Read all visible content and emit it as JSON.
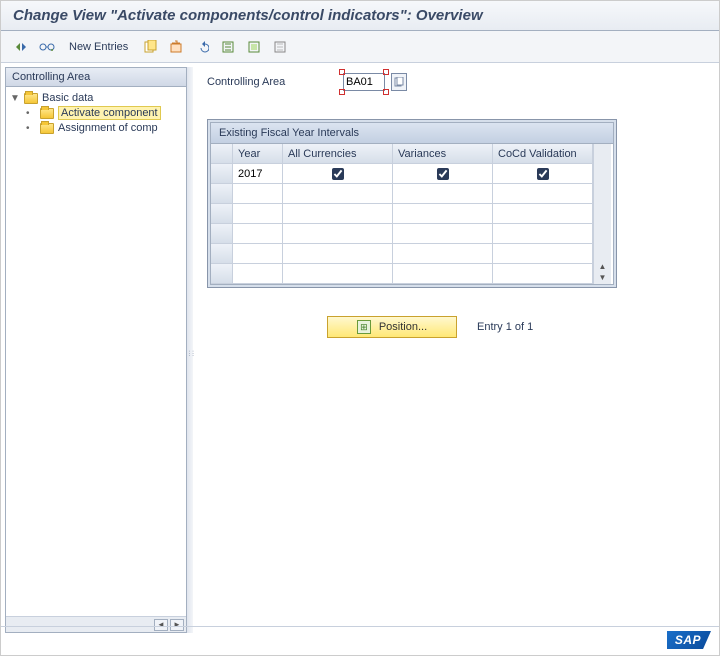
{
  "title": "Change View \"Activate components/control indicators\": Overview",
  "toolbar": {
    "new_entries": "New Entries"
  },
  "nav": {
    "header": "Controlling Area",
    "root": "Basic data",
    "items": [
      "Activate component",
      "Assignment of comp"
    ]
  },
  "field": {
    "label": "Controlling Area",
    "value": "BA01"
  },
  "table": {
    "title": "Existing Fiscal Year Intervals",
    "columns": [
      "Year",
      "All Currencies",
      "Variances",
      "CoCd Validation"
    ],
    "rows": [
      {
        "year": "2017",
        "all_currencies": true,
        "variances": true,
        "cocd_validation": true
      }
    ]
  },
  "position": {
    "label": "Position...",
    "entry_text": "Entry 1 of 1"
  },
  "logo": "SAP"
}
